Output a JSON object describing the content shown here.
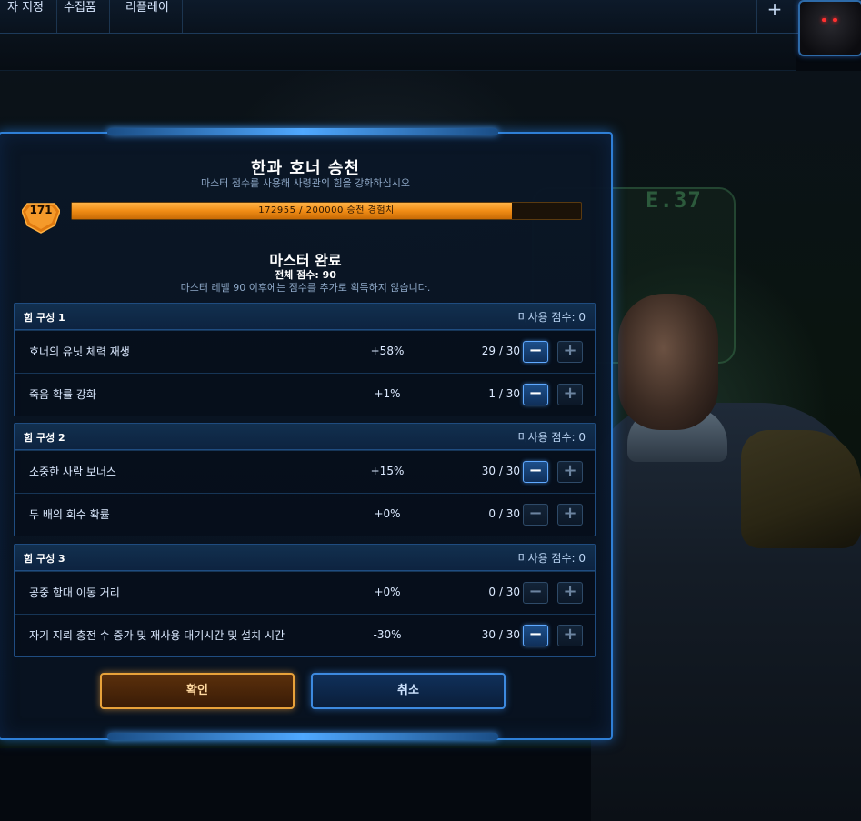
{
  "nav": {
    "tabs": [
      "자 지정",
      "수집품",
      "리플레이"
    ],
    "plus_label": "+"
  },
  "dialog": {
    "title": "한과 호너 승천",
    "subtitle": "마스터 점수를 사용해 사령관의 힘을 강화하십시오",
    "level": "171",
    "xp_text": "172955 / 200000 승천 경험치",
    "xp_progress": 0.865,
    "mastery_title": "마스터 완료",
    "total_points": "전체 점수: 90",
    "mastery_note": "마스터 레벨 90 이후에는 점수를 추가로 획득하지 않습니다.",
    "confirm_label": "확인",
    "cancel_label": "취소"
  },
  "sets": [
    {
      "name": "힘 구성 1",
      "unused": "미사용 점수: 0",
      "rows": [
        {
          "name": "호너의 유닛 체력 재생",
          "bonus": "+58%",
          "points": "29 / 30",
          "minus": "−",
          "plus": "+",
          "minus_enabled": true,
          "plus_enabled": false
        },
        {
          "name": "죽음 확률 강화",
          "bonus": "+1%",
          "points": "1 / 30",
          "minus": "−",
          "plus": "+",
          "minus_enabled": true,
          "plus_enabled": false
        }
      ]
    },
    {
      "name": "힘 구성 2",
      "unused": "미사용 점수: 0",
      "rows": [
        {
          "name": "소중한 사람 보너스",
          "bonus": "+15%",
          "points": "30 / 30",
          "minus": "−",
          "plus": "+",
          "minus_enabled": true,
          "plus_enabled": false
        },
        {
          "name": "두 배의 회수 확률",
          "bonus": "+0%",
          "points": "0 / 30",
          "minus": "−",
          "plus": "+",
          "minus_enabled": false,
          "plus_enabled": false
        }
      ]
    },
    {
      "name": "힘 구성 3",
      "unused": "미사용 점수: 0",
      "rows": [
        {
          "name": "공중 함대 이동 거리",
          "bonus": "+0%",
          "points": "0 / 30",
          "minus": "−",
          "plus": "+",
          "minus_enabled": false,
          "plus_enabled": false
        },
        {
          "name": "자기 지뢰 충전 수 증가 및 재사용 대기시간 및 설치 시간",
          "bonus": "-30%",
          "points": "30 / 30",
          "minus": "−",
          "plus": "+",
          "minus_enabled": true,
          "plus_enabled": false
        }
      ]
    }
  ],
  "background": {
    "bunker_label": "E.37"
  }
}
